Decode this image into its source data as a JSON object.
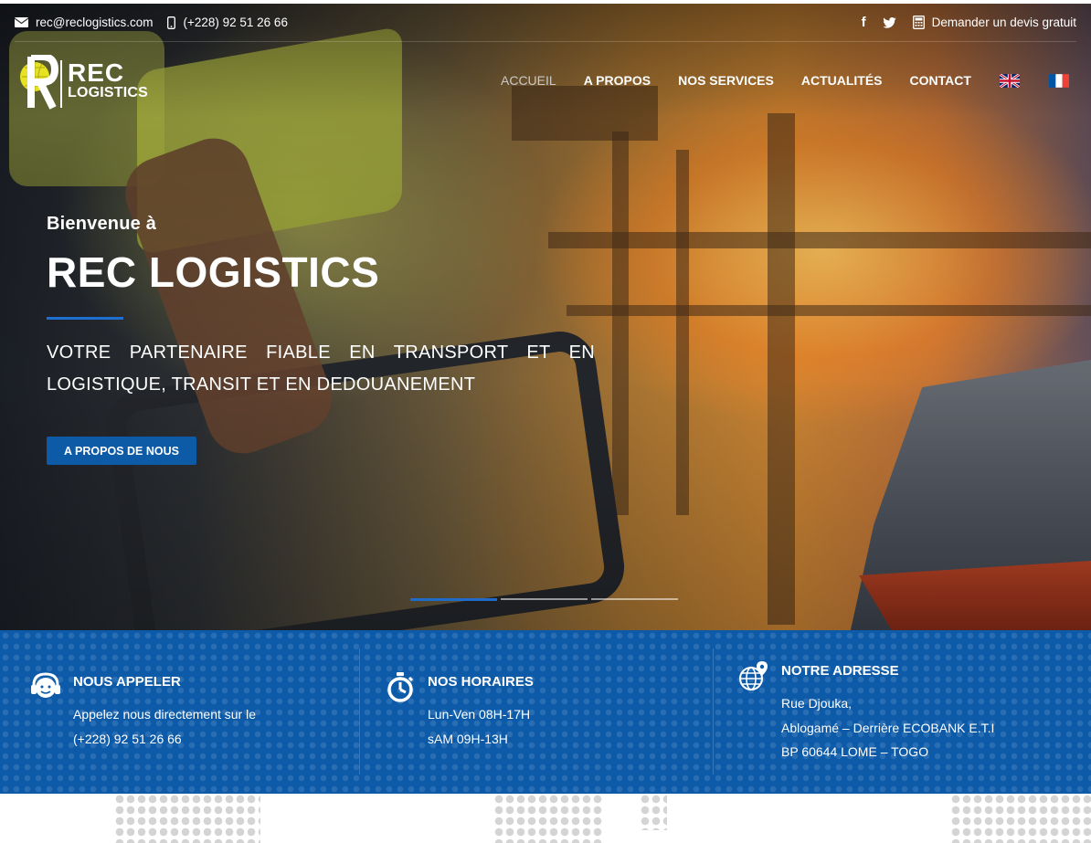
{
  "topbar": {
    "email": "rec@reclogistics.com",
    "phone": "(+228) 92 51 26 66",
    "quote_label": "Demander un devis gratuit"
  },
  "logo": {
    "line1": "REC",
    "line2": "LOGISTICS"
  },
  "nav": {
    "items": [
      "ACCUEIL",
      "A PROPOS",
      "NOS SERVICES",
      "ACTUALITÉS",
      "CONTACT"
    ],
    "active": "ACCUEIL"
  },
  "hero": {
    "welcome": "Bienvenue à",
    "title": "REC LOGISTICS",
    "tagline": "VOTRE PARTENAIRE FIABLE EN TRANSPORT ET EN LOGISTIQUE, TRANSIT ET EN DEDOUANEMENT",
    "cta_label": "A PROPOS DE NOUS",
    "slide_index": 1,
    "slide_count": 3
  },
  "info": {
    "call": {
      "title": "NOUS APPELER",
      "line1": "Appelez nous directement sur le",
      "line2": "(+228) 92 51 26 66"
    },
    "hours": {
      "title": "NOS HORAIRES",
      "line1": "Lun-Ven 08H-17H",
      "line2": "sAM 09H-13H"
    },
    "address": {
      "title": "NOTRE ADRESSE",
      "line1": "Rue Djouka,",
      "line2": "Ablogamé – Derrière ECOBANK E.T.I",
      "line3": "BP 60644 LOME – TOGO"
    }
  },
  "colors": {
    "primary": "#0c5aa8",
    "accent": "#1f6fd0"
  }
}
